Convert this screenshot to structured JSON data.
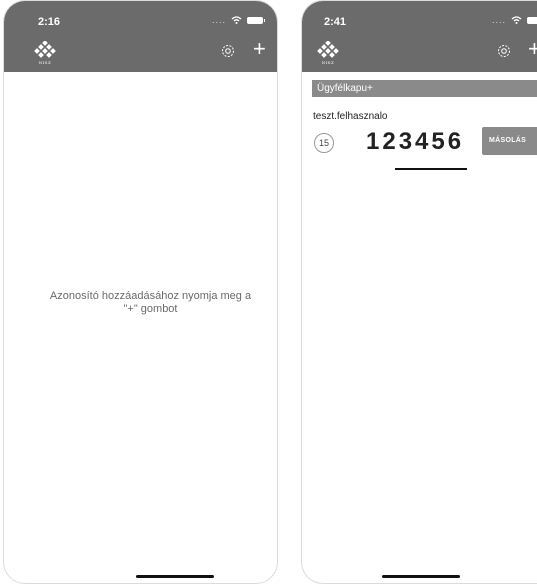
{
  "screens": [
    {
      "status_time": "2:16",
      "logo_text": "NISZ",
      "empty_message": "Azonosító hozzáadásához nyomja meg a \"+\" gombot",
      "add_label": "+"
    },
    {
      "status_time": "2:41",
      "logo_text": "NISZ",
      "add_label": "+",
      "account": {
        "service": "Ügyfélkapu+",
        "username": "teszt.felhasznalo",
        "timer": "15",
        "code": "123456",
        "copy_label": "MÁSOLÁS"
      }
    }
  ],
  "colors": {
    "appbar": "#6b6b6b",
    "account_header": "#8a8a8a",
    "copy_button": "#8a8a8a"
  },
  "icons": [
    "nisz-logo-icon",
    "gear-icon",
    "plus-icon",
    "wifi-icon",
    "battery-icon"
  ]
}
